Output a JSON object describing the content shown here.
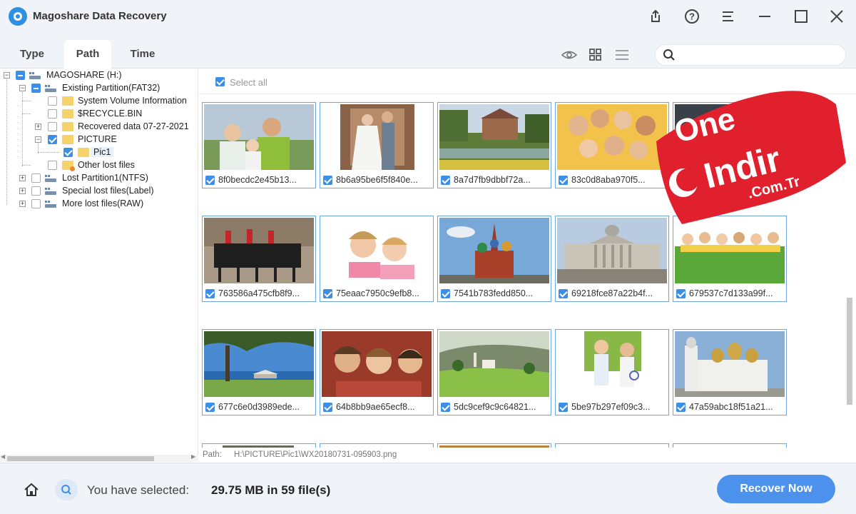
{
  "window": {
    "title": "Magoshare Data Recovery",
    "icons": [
      "export-icon",
      "help-icon",
      "menu-icon",
      "minimize-icon",
      "maximize-icon",
      "close-icon"
    ]
  },
  "tabs": [
    {
      "label": "Type",
      "active": false
    },
    {
      "label": "Path",
      "active": true
    },
    {
      "label": "Time",
      "active": false
    }
  ],
  "view_icons": [
    "eye-icon",
    "grid-view-icon",
    "list-view-icon"
  ],
  "search": {
    "value": "",
    "placeholder": ""
  },
  "tree": [
    {
      "label": "MAGOSHARE (H:)",
      "icon": "drive-icon",
      "check": "partial"
    },
    {
      "label": "Existing Partition(FAT32)",
      "icon": "drive-icon",
      "check": "partial"
    },
    {
      "label": "System Volume Information",
      "icon": "folder-icon",
      "check": "none"
    },
    {
      "label": "$RECYCLE.BIN",
      "icon": "folder-icon",
      "check": "none"
    },
    {
      "label": "Recovered data 07-27-2021",
      "icon": "folder-icon",
      "check": "none"
    },
    {
      "label": "PICTURE",
      "icon": "folder-icon",
      "check": "checked"
    },
    {
      "label": "Pic1",
      "icon": "folder-icon",
      "check": "checked"
    },
    {
      "label": "Other lost files",
      "icon": "folder-icon",
      "check": "none"
    },
    {
      "label": "Lost Partition1(NTFS)",
      "icon": "drive-icon",
      "check": "none"
    },
    {
      "label": "Special lost files(Label)",
      "icon": "drive-icon",
      "check": "none"
    },
    {
      "label": "More lost files(RAW)",
      "icon": "drive-icon",
      "check": "none"
    }
  ],
  "content": {
    "select_all_label": "Select all",
    "files": [
      {
        "name": "8f0becdc2e45b13...",
        "thumb": "family-photo"
      },
      {
        "name": "8b6a95be6f5f840e...",
        "thumb": "wedding-photo"
      },
      {
        "name": "8a7d7fb9dbbf72a...",
        "thumb": "river-village-photo"
      },
      {
        "name": "83c0d8aba970f5...",
        "thumb": "group-faces-photo"
      },
      {
        "name": "",
        "thumb": "dark-photo"
      },
      {
        "name": "763586a475cfb8f9...",
        "thumb": "horse-guards-photo"
      },
      {
        "name": "75eaac7950c9efb8...",
        "thumb": "two-kids-photo"
      },
      {
        "name": "7541b783fedd850...",
        "thumb": "cathedral-photo"
      },
      {
        "name": "69218fce87a22b4f...",
        "thumb": "gallery-building-photo"
      },
      {
        "name": "679537c7d133a99f...",
        "thumb": "kids-grass-photo"
      },
      {
        "name": "677c6e0d3989ede...",
        "thumb": "tree-beach-photo"
      },
      {
        "name": "64b8bb9ae65ecf8...",
        "thumb": "three-friends-photo"
      },
      {
        "name": "5dc9cef9c9c64821...",
        "thumb": "hills-village-photo"
      },
      {
        "name": "5be97b297ef09c3...",
        "thumb": "kids-tennis-photo"
      },
      {
        "name": "47a59abc18f51a21...",
        "thumb": "white-church-photo"
      }
    ],
    "path_label": "Path:",
    "path_value": "H:\\PICTURE\\Pic1\\WX20180731-095903.png"
  },
  "bottom": {
    "selected_label": "You have selected:",
    "selected_value": "29.75 MB in 59 file(s)",
    "recover_label": "Recover Now"
  },
  "watermark": {
    "line1": "One",
    "line2": "Indir",
    "line3": ".Com.Tr"
  },
  "colors": {
    "accent": "#4c92ec",
    "card_border": "#6fa6e6",
    "watermark_red": "#e0202c"
  }
}
